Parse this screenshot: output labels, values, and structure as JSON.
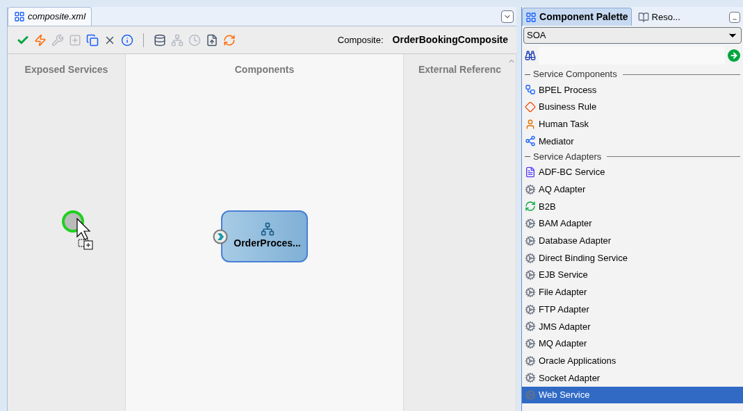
{
  "editor": {
    "tab": {
      "title": "composite.xml",
      "selected": true
    },
    "toolbar": [
      {
        "disabled": false
      },
      {
        "disabled": false
      },
      {
        "disabled": true
      },
      {
        "disabled": true
      },
      {
        "disabled": false
      },
      {
        "disabled": false
      },
      {
        "disabled": false
      },
      {
        "disabled": false
      },
      {
        "disabled": true
      },
      {
        "disabled": true
      },
      {
        "disabled": false
      },
      {
        "disabled": false
      }
    ],
    "composite_label": "Composite:",
    "composite_name": "OrderBookingComposite",
    "columns": [
      "Exposed Services",
      "Components",
      "External Referenc"
    ],
    "components": [
      {
        "name": "OrderProces..."
      }
    ]
  },
  "palette": {
    "tabs": [
      {
        "label": "Component Palette",
        "selected": true
      },
      {
        "label": "Reso...",
        "selected": false
      }
    ],
    "library": "SOA",
    "items": [
      {
        "kind": "header",
        "label": "Service Components"
      },
      {
        "kind": "item",
        "label": "BPEL Process",
        "selected": false
      },
      {
        "kind": "item",
        "label": "Business Rule",
        "selected": false
      },
      {
        "kind": "item",
        "label": "Human Task",
        "selected": false
      },
      {
        "kind": "item",
        "label": "Mediator",
        "selected": false
      },
      {
        "kind": "header",
        "label": "Service Adapters"
      },
      {
        "kind": "item",
        "label": "ADF-BC Service",
        "selected": false
      },
      {
        "kind": "item",
        "label": "AQ Adapter",
        "selected": false
      },
      {
        "kind": "item",
        "label": "B2B",
        "selected": false
      },
      {
        "kind": "item",
        "label": "BAM Adapter",
        "selected": false
      },
      {
        "kind": "item",
        "label": "Database Adapter",
        "selected": false
      },
      {
        "kind": "item",
        "label": "Direct Binding Service",
        "selected": false
      },
      {
        "kind": "item",
        "label": "EJB Service",
        "selected": false
      },
      {
        "kind": "item",
        "label": "File Adapter",
        "selected": false
      },
      {
        "kind": "item",
        "label": "FTP Adapter",
        "selected": false
      },
      {
        "kind": "item",
        "label": "JMS Adapter",
        "selected": false
      },
      {
        "kind": "item",
        "label": "MQ Adapter",
        "selected": false
      },
      {
        "kind": "item",
        "label": "Oracle Applications",
        "selected": false
      },
      {
        "kind": "item",
        "label": "Socket Adapter",
        "selected": false
      },
      {
        "kind": "item",
        "label": "Web Service",
        "selected": true
      }
    ]
  }
}
